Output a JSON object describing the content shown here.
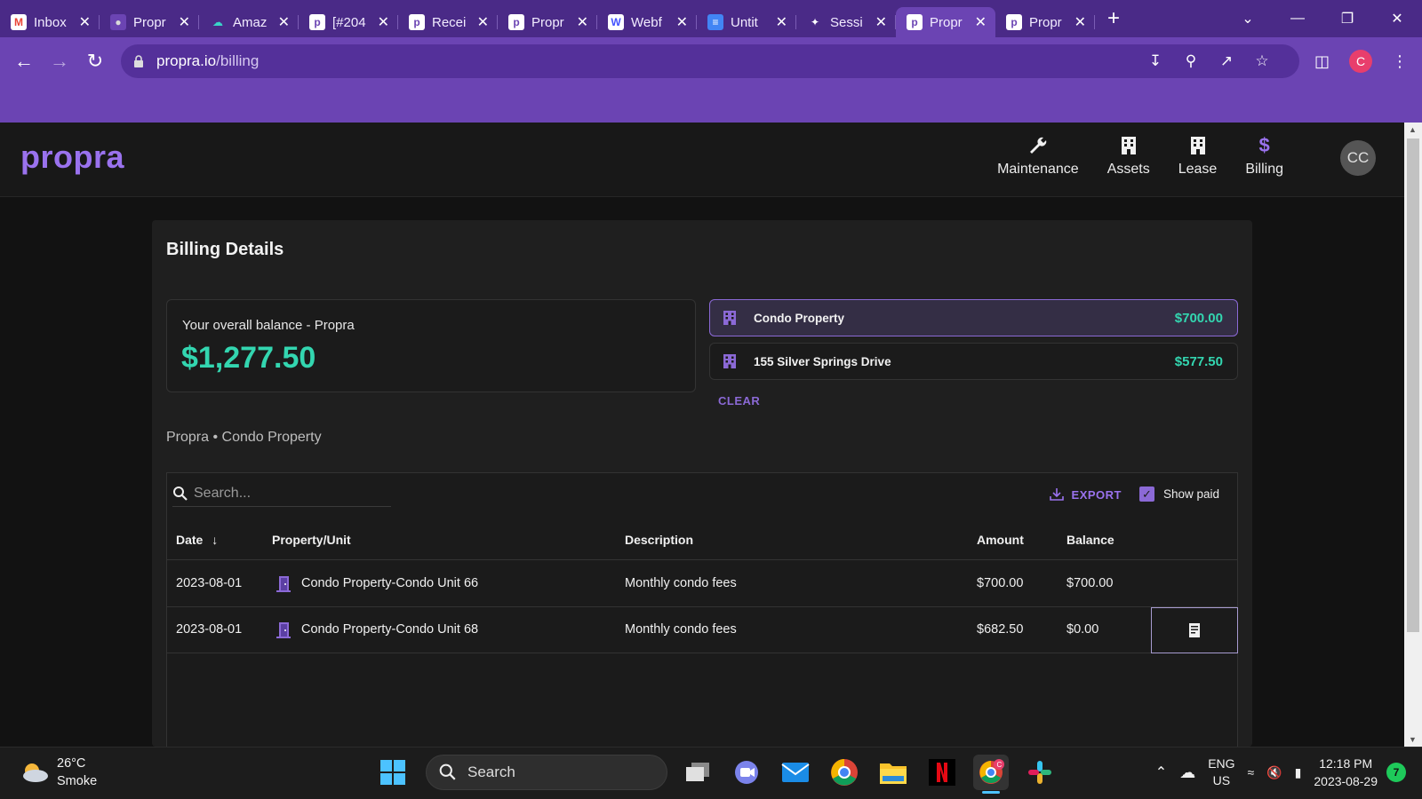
{
  "browser": {
    "tabs": [
      {
        "title": "Inbox",
        "fav": "M",
        "fav_bg": "#ffffff",
        "fav_fg": "#ea4335"
      },
      {
        "title": "Propr",
        "fav": "●",
        "fav_bg": "#6b44b3",
        "fav_fg": "#d9d9d9"
      },
      {
        "title": "Amaz",
        "fav": "☁",
        "fav_bg": "transparent",
        "fav_fg": "#3ad3c8"
      },
      {
        "title": "[#204",
        "fav": "p",
        "fav_bg": "#ffffff",
        "fav_fg": "#6b44b3"
      },
      {
        "title": "Recei",
        "fav": "p",
        "fav_bg": "#ffffff",
        "fav_fg": "#6b44b3"
      },
      {
        "title": "Propr",
        "fav": "p",
        "fav_bg": "#ffffff",
        "fav_fg": "#6b44b3"
      },
      {
        "title": "Webf",
        "fav": "W",
        "fav_bg": "#ffffff",
        "fav_fg": "#4353ff"
      },
      {
        "title": "Untit",
        "fav": "≡",
        "fav_bg": "#4285f4",
        "fav_fg": "#ffffff"
      },
      {
        "title": "Sessi",
        "fav": "✦",
        "fav_bg": "transparent",
        "fav_fg": "#ffffff"
      },
      {
        "title": "Propr",
        "fav": "p",
        "fav_bg": "#ffffff",
        "fav_fg": "#6b44b3",
        "active": true
      },
      {
        "title": "Propr",
        "fav": "p",
        "fav_bg": "#ffffff",
        "fav_fg": "#6b44b3"
      }
    ],
    "url_host": "propra.io",
    "url_path": "/billing",
    "profile_initial": "C"
  },
  "app": {
    "logo": "propra",
    "nav": [
      {
        "label": "Maintenance",
        "icon": "wrench-icon"
      },
      {
        "label": "Assets",
        "icon": "building-icon"
      },
      {
        "label": "Lease",
        "icon": "building-icon"
      },
      {
        "label": "Billing",
        "icon": "dollar-icon",
        "active": true
      }
    ],
    "avatar_initials": "CC"
  },
  "billing": {
    "title": "Billing Details",
    "balance_label": "Your overall balance - Propra",
    "balance_amount": "$1,277.50",
    "properties": [
      {
        "name": "Condo Property",
        "amount": "$700.00",
        "selected": true
      },
      {
        "name": "155 Silver Springs Drive",
        "amount": "$577.50",
        "selected": false
      }
    ],
    "clear_label": "CLEAR",
    "breadcrumb": "Propra • Condo Property",
    "search_placeholder": "Search...",
    "export_label": "EXPORT",
    "show_paid_label": "Show paid",
    "show_paid_checked": true,
    "columns": [
      "Date",
      "Property/Unit",
      "Description",
      "Amount",
      "Balance"
    ],
    "rows": [
      {
        "date": "2023-08-01",
        "unit": "Condo Property-Condo Unit 66",
        "description": "Monthly condo fees",
        "amount": "$700.00",
        "balance": "$700.00",
        "receipt": false
      },
      {
        "date": "2023-08-01",
        "unit": "Condo Property-Condo Unit 68",
        "description": "Monthly condo fees",
        "amount": "$682.50",
        "balance": "$0.00",
        "receipt": true
      }
    ]
  },
  "taskbar": {
    "temperature": "26°C",
    "condition": "Smoke",
    "search_label": "Search",
    "lang_top": "ENG",
    "lang_bottom": "US",
    "time": "12:18 PM",
    "date": "2023-08-29",
    "notifications": "7"
  },
  "colors": {
    "accent": "#9a72ee",
    "money": "#33d6b0",
    "chrome": "#6b44b3"
  }
}
